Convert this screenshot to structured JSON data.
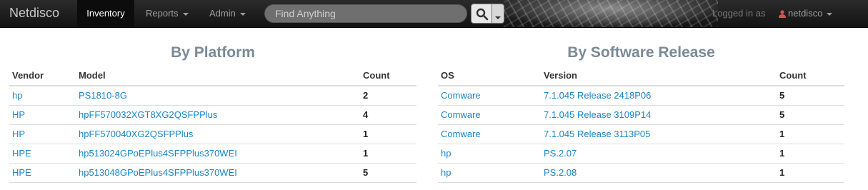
{
  "nav": {
    "brand": "Netdisco",
    "items": [
      {
        "label": "Inventory",
        "active": true
      },
      {
        "label": "Reports"
      },
      {
        "label": "Admin"
      }
    ],
    "search_placeholder": "Find Anything",
    "logged_in_text": "Logged in as",
    "username": "netdisco"
  },
  "platform": {
    "title": "By Platform",
    "headers": [
      "Vendor",
      "Model",
      "Count"
    ],
    "rows": [
      {
        "vendor": "hp",
        "model": "PS1810-8G",
        "count": "2"
      },
      {
        "vendor": "HP",
        "model": "hpFF570032XGT8XG2QSFPPlus",
        "count": "4"
      },
      {
        "vendor": "HP",
        "model": "hpFF570040XG2QSFPPlus",
        "count": "1"
      },
      {
        "vendor": "HPE",
        "model": "hp513024GPoEPlus4SFPPlus370WEI",
        "count": "1"
      },
      {
        "vendor": "HPE",
        "model": "hp513048GPoEPlus4SFPPlus370WEI",
        "count": "5"
      }
    ]
  },
  "software": {
    "title": "By Software Release",
    "headers": [
      "OS",
      "Version",
      "Count"
    ],
    "rows": [
      {
        "os": "Comware",
        "version": "7.1.045 Release 2418P06",
        "count": "5"
      },
      {
        "os": "Comware",
        "version": "7.1.045 Release 3109P14",
        "count": "5"
      },
      {
        "os": "Comware",
        "version": "7.1.045 Release 3113P05",
        "count": "1"
      },
      {
        "os": "hp",
        "version": "PS.2.07",
        "count": "1"
      },
      {
        "os": "hp",
        "version": "PS.2.08",
        "count": "1"
      }
    ]
  },
  "colors": {
    "link": "#1a86c8",
    "title": "#7a8a96",
    "navbar": "#1b1b1b"
  }
}
